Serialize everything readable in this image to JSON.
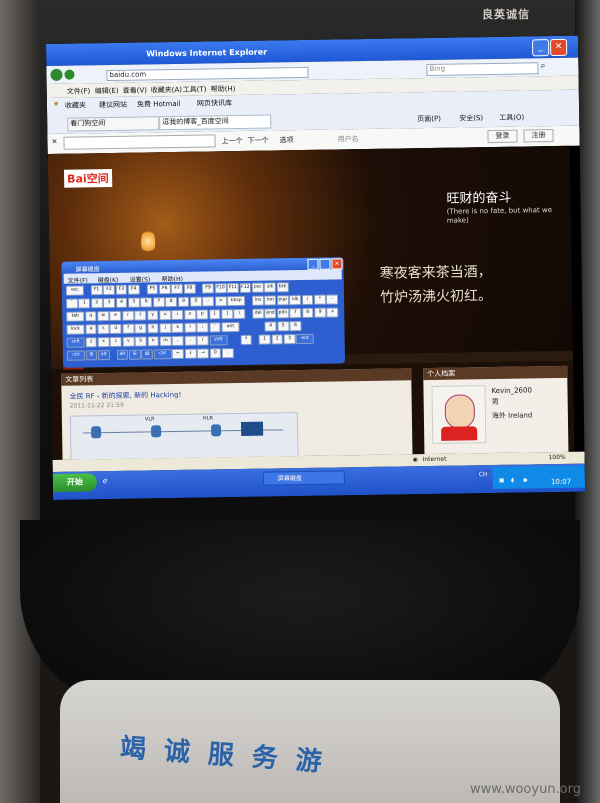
{
  "kiosk": {
    "brand": "良英诚信",
    "slogan": "竭诚服务游",
    "watermark": "www.wooyun.org"
  },
  "browser": {
    "window_title": "Windows Internet Explorer",
    "address": "baidu.com",
    "search_placeholder": "Bing",
    "menu": [
      "文件(F)",
      "编辑(E)",
      "查看(V)",
      "收藏夹(A)",
      "工具(T)",
      "帮助(H)"
    ],
    "favorites": [
      "收藏夹",
      "建议网站",
      "免费 Hotmail",
      "网页快讯库"
    ],
    "tabs": [
      "看门狗空间",
      "逗我的博客_百度空间"
    ],
    "toolbar": [
      "页面(P)",
      "安全(S)",
      "工具(O)"
    ],
    "find_prev": "上一个",
    "find_next": "下一个",
    "find_options": "选项",
    "user_label": "用户名",
    "login": "登录",
    "register": "注册",
    "status_zone": "Internet",
    "zoom": "100%"
  },
  "blog": {
    "logo": "Bai空间",
    "title": "旺财的奋斗",
    "motto": "(There is no fate, but what we make)",
    "poem_line1": "寒夜客来茶当酒，",
    "poem_line2": "竹炉汤沸火初红。",
    "nav": [
      "主页",
      "博客",
      "相册",
      "个人档案",
      "好友",
      "i贴吧"
    ],
    "article_header": "文章列表",
    "article_title": "全民 RF - 新的探索, 新的 Hacking!",
    "article_date": "2011-11-22 21:59",
    "diagram_labels": [
      "VLR",
      "HLR"
    ],
    "profile_header": "个人档案",
    "profile_name": "Kevin_2600",
    "profile_sex": "男",
    "profile_location": "海外 Ireland"
  },
  "osk": {
    "title": "屏幕键盘",
    "menu": [
      "文件(F)",
      "键盘(K)",
      "设置(S)",
      "帮助(H)"
    ],
    "rows": [
      [
        "esc",
        "",
        "F1",
        "F2",
        "F3",
        "F4",
        "",
        "F5",
        "F6",
        "F7",
        "F8",
        "",
        "F9",
        "F10",
        "F11",
        "F12",
        "psc",
        "slk",
        "brk"
      ],
      [
        "`",
        "1",
        "2",
        "3",
        "4",
        "5",
        "6",
        "7",
        "8",
        "9",
        "0",
        "-",
        "=",
        "bksp",
        "",
        "ins",
        "hm",
        "pup",
        "nlk",
        "/",
        "*",
        "-"
      ],
      [
        "tab",
        "q",
        "w",
        "e",
        "r",
        "t",
        "y",
        "u",
        "i",
        "o",
        "p",
        "[",
        "]",
        "\\",
        "",
        "del",
        "end",
        "pdn",
        "7",
        "8",
        "9",
        "+"
      ],
      [
        "lock",
        "a",
        "s",
        "d",
        "f",
        "g",
        "h",
        "j",
        "k",
        "l",
        ";",
        "'",
        "ent",
        "",
        "",
        "",
        "",
        "4",
        "5",
        "6"
      ],
      [
        "shft",
        "z",
        "x",
        "c",
        "v",
        "b",
        "n",
        "m",
        ",",
        ".",
        "/",
        "shft",
        "",
        "",
        "↑",
        "",
        "1",
        "2",
        "3",
        "ent"
      ],
      [
        "ctrl",
        "⊞",
        "alt",
        "",
        "alt",
        "⊞",
        "▤",
        "ctrl",
        "←",
        "↓",
        "→",
        "0",
        "."
      ]
    ]
  },
  "taskbar": {
    "start": "开始",
    "task_osk": "屏幕键盘",
    "lang": "CH",
    "time": "10:07"
  }
}
